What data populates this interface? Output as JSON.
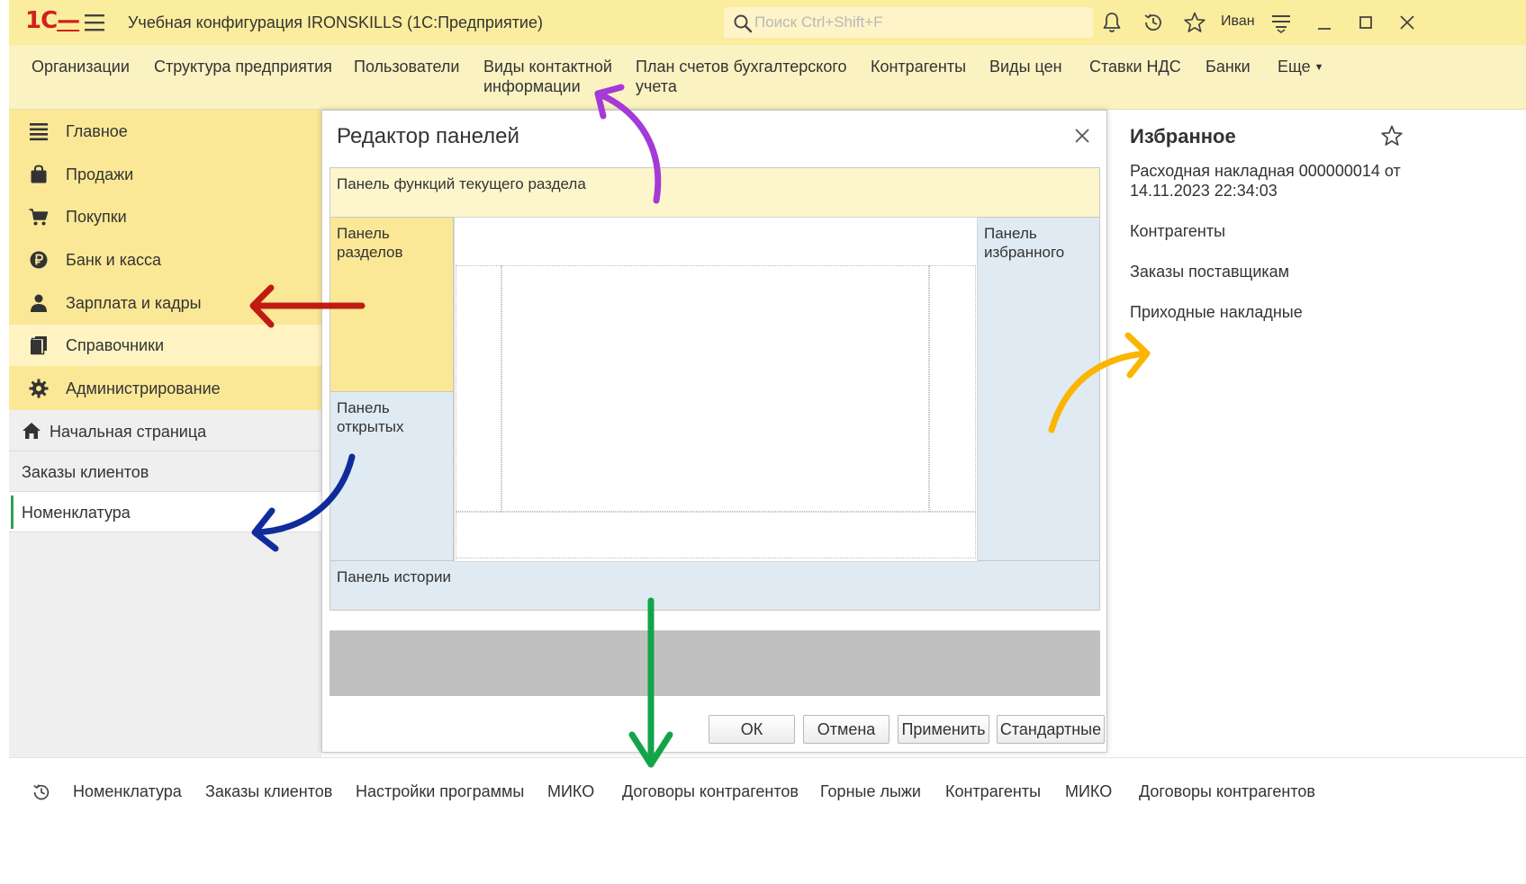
{
  "titlebar": {
    "logo": "1С",
    "app_title": "Учебная конфигурация IRONSKILLS  (1С:Предприятие)",
    "search_placeholder": "Поиск Ctrl+Shift+F",
    "user_name": "Иван"
  },
  "navbar": {
    "items": [
      "Организации",
      "Структура предприятия",
      "Пользователи",
      "Виды контактной информации",
      "План счетов бухгалтерского учета",
      "Контрагенты",
      "Виды цен",
      "Ставки НДС",
      "Банки"
    ],
    "more_label": "Еще"
  },
  "sidebar": {
    "sections": [
      {
        "label": "Главное",
        "icon": "menu-lines-icon"
      },
      {
        "label": "Продажи",
        "icon": "shopping-bag-icon"
      },
      {
        "label": "Покупки",
        "icon": "cart-icon"
      },
      {
        "label": "Банк и касса",
        "icon": "ruble-coin-icon"
      },
      {
        "label": "Зарплата и кадры",
        "icon": "person-icon"
      },
      {
        "label": "Справочники",
        "icon": "books-icon"
      },
      {
        "label": "Администрирование",
        "icon": "gear-icon"
      }
    ],
    "active_section": "Справочники",
    "open_windows": [
      {
        "label": "Начальная страница",
        "icon": "home-icon"
      },
      {
        "label": "Заказы клиентов"
      },
      {
        "label": "Номенклатура"
      }
    ]
  },
  "dialog": {
    "title": "Редактор панелей",
    "panels": {
      "functions": "Панель функций текущего раздела",
      "sections": "Панель разделов",
      "open": "Панель открытых",
      "favorites": "Панель избранного",
      "history": "Панель истории"
    },
    "buttons": {
      "ok": "ОК",
      "cancel": "Отмена",
      "apply": "Применить",
      "standard": "Стандартные"
    }
  },
  "favorites": {
    "title": "Избранное",
    "items": [
      "Расходная накладная 000000014 от 14.11.2023 22:34:03",
      "Контрагенты",
      "Заказы поставщикам",
      "Приходные накладные"
    ]
  },
  "history": {
    "items": [
      "Номенклатура",
      "Заказы клиентов",
      "Настройки программы",
      "МИКО",
      "Договоры контрагентов",
      "Горные лыжи",
      "Контрагенты",
      "МИКО",
      "Договоры контрагентов"
    ]
  },
  "colors": {
    "titlebar_bg": "#fbed9e",
    "navbar_bg": "#fbf2c2",
    "sections_bg": "#fbe896",
    "section_active_bg": "#fff3c2",
    "panel_yellow": "#fbe896",
    "panel_yellow_light": "#fdf6cc",
    "panel_blue": "#dfeaf2",
    "arrow_purple": "#a43bd6",
    "arrow_red": "#c01b12",
    "arrow_blue": "#102c9c",
    "arrow_orange": "#fbb500",
    "arrow_green": "#13a44a"
  }
}
